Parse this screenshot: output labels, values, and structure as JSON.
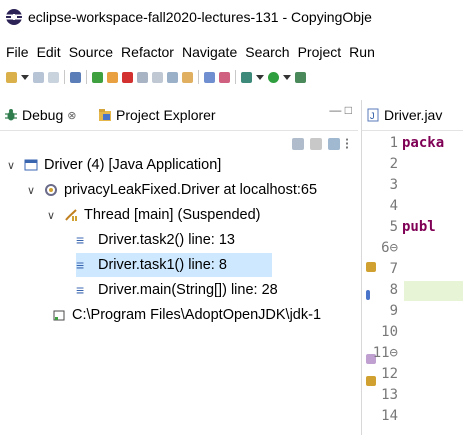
{
  "window": {
    "title": "eclipse-workspace-fall2020-lectures-131 - CopyingObje"
  },
  "menu": [
    "File",
    "Edit",
    "Source",
    "Refactor",
    "Navigate",
    "Search",
    "Project",
    "Run"
  ],
  "debug_view": {
    "tabs": [
      {
        "label": "Debug",
        "close": "⊗",
        "active": true
      },
      {
        "label": "Project Explorer",
        "active": false
      }
    ],
    "window_controls": "—  □",
    "tree": [
      {
        "label": "Driver (4) [Java Application]",
        "icon": "java-application-icon"
      },
      {
        "label": "privacyLeakFixed.Driver at localhost:65",
        "icon": "debug-target-icon"
      },
      {
        "label": "Thread [main] (Suspended)",
        "icon": "thread-suspended-icon"
      },
      {
        "label": "Driver.task2() line: 13",
        "icon": "stack-frame-icon"
      },
      {
        "label": "Driver.task1() line: 8",
        "icon": "stack-frame-icon",
        "selected": true
      },
      {
        "label": "Driver.main(String[]) line: 28",
        "icon": "stack-frame-icon"
      },
      {
        "label": "C:\\Program Files\\AdoptOpenJDK\\jdk-1",
        "icon": "jvm-process-icon"
      }
    ]
  },
  "editor": {
    "tab_label": "Driver.jav",
    "line_numbers": [
      "1",
      "2",
      "3",
      "4",
      "5",
      "6⊖",
      "7",
      "8",
      "9",
      "10",
      "11⊖",
      "12",
      "13",
      "14"
    ],
    "code": [
      {
        "line": "1",
        "text": "packa"
      },
      {
        "line": "5",
        "text": "publ"
      }
    ]
  },
  "colors": {
    "selection": "#cde8ff",
    "keyword": "#7f0055",
    "current_line": "#e7f5d6"
  }
}
